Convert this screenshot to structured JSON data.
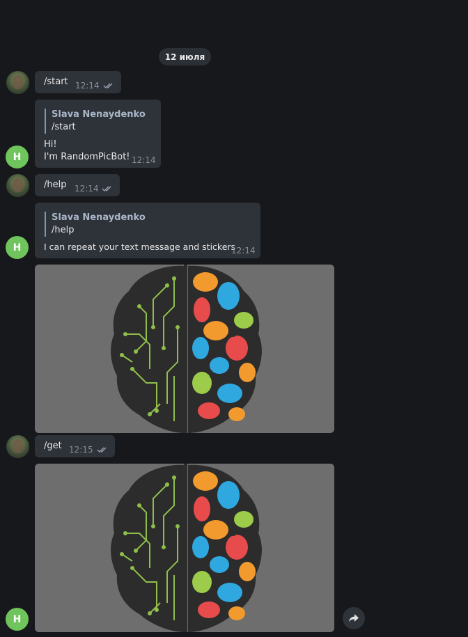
{
  "date_separator": "12 июля",
  "messages": [
    {
      "type": "user",
      "text": "/start",
      "time": "12:14"
    },
    {
      "type": "bot",
      "reply_author": "Slava Nenaydenko",
      "reply_text": "/start",
      "lines": [
        "Hi!",
        "I'm RandomPicBot!"
      ],
      "time": "12:14"
    },
    {
      "type": "user",
      "text": "/help",
      "time": "12:14"
    },
    {
      "type": "bot",
      "reply_author": "Slava Nenaydenko",
      "reply_text": "/help",
      "lines": [
        "I can repeat your text message and stickers"
      ],
      "time": "12:14"
    },
    {
      "type": "bot_photo",
      "image": "brain-circuit-colorful"
    },
    {
      "type": "user",
      "text": "/get",
      "time": "12:15"
    },
    {
      "type": "bot_photo",
      "image": "brain-circuit-colorful"
    }
  ],
  "bot_avatar_letter": "H",
  "icons": {
    "read_status": "double-check-icon",
    "share": "share-arrow-icon"
  },
  "colors": {
    "background": "#17181c",
    "bubble": "#2e3239",
    "bot_avatar": "#6fc45b",
    "reply_author": "#a9b6c7",
    "photo_background": "#6e6e6e"
  }
}
